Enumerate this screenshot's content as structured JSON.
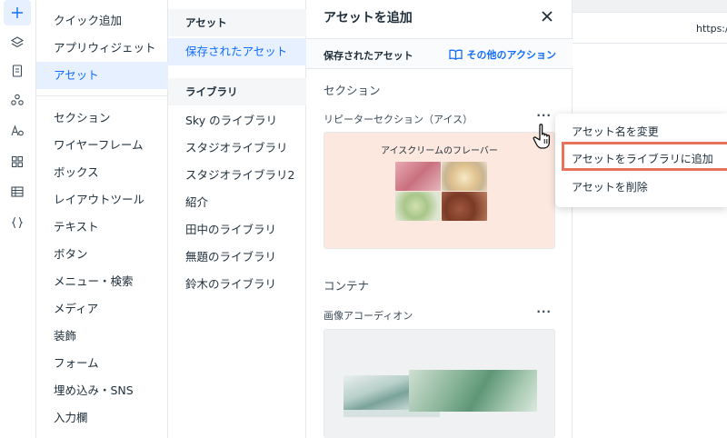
{
  "rail": {
    "icons": [
      "add-icon",
      "layers-icon",
      "page-icon",
      "apps-icon",
      "theme-icon",
      "grid-icon",
      "table-icon",
      "code-icon"
    ]
  },
  "col1": {
    "items_top": [
      "クイック追加",
      "アプリウィジェット",
      "アセット"
    ],
    "items": [
      "セクション",
      "ワイヤーフレーム",
      "ボックス",
      "レイアウトツール",
      "テキスト",
      "ボタン",
      "メニュー・検索",
      "メディア",
      "装飾",
      "フォーム",
      "埋め込み・SNS",
      "入力欄"
    ]
  },
  "col2": {
    "header_assets": "アセット",
    "saved_assets": "保存されたアセット",
    "header_library": "ライブラリ",
    "libraries": [
      "Sky のライブラリ",
      "スタジオライブラリ",
      "スタジオライブラリ2",
      "紹介",
      "田中のライブラリ",
      "無題のライブラリ",
      "鈴木のライブラリ"
    ]
  },
  "panel": {
    "title": "アセットを追加",
    "subbar_label": "保存されたアセット",
    "subbar_action": "その他のアクション",
    "section_title": "セクション",
    "asset1_label": "リピーターセクション（アイス）",
    "asset1_card_title": "アイスクリームのフレーバー",
    "section2_title": "コンテナ",
    "asset2_label": "画像アコーディオン",
    "more": "···"
  },
  "context_menu": {
    "items": [
      "アセット名を変更",
      "アセットをライブラリに追加",
      "アセットを削除"
    ]
  },
  "right": {
    "url": "https://"
  },
  "colors": {
    "accent": "#116dff",
    "selected_bg": "#e7f0ff",
    "highlight": "#e8735c",
    "card_bg": "#fde8df"
  }
}
